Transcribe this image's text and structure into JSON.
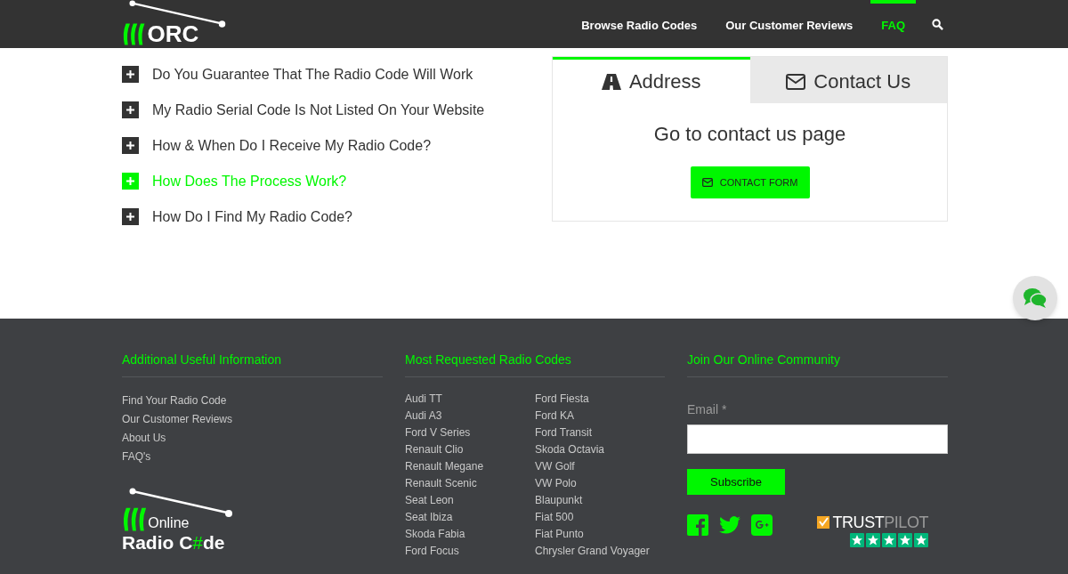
{
  "header": {
    "logo_text": "ORC",
    "nav": [
      {
        "label": "Browse Radio Codes",
        "selected": false
      },
      {
        "label": "Our Customer Reviews",
        "selected": false
      },
      {
        "label": "FAQ",
        "selected": true
      }
    ]
  },
  "faq": [
    {
      "question": "Do You Guarantee That The Radio Code Will Work",
      "selected": false
    },
    {
      "question": "My Radio Serial Code Is Not Listed On Your Website",
      "selected": false
    },
    {
      "question": "How & When Do I Receive My Radio Code?",
      "selected": false
    },
    {
      "question": "How Does The Process Work?",
      "selected": true
    },
    {
      "question": "How Do I Find My Radio Code?",
      "selected": false
    }
  ],
  "contact_panel": {
    "tabs": [
      {
        "label": "Address",
        "kind": "road",
        "selected": true
      },
      {
        "label": "Contact Us",
        "kind": "mail",
        "selected": false
      }
    ],
    "heading": "Go to contact us page",
    "button": "CONTACT FORM"
  },
  "footer": {
    "useful": {
      "title": "Additional Useful Information",
      "links": [
        "Find Your Radio Code",
        "Our Customer Reviews",
        "About Us",
        "FAQ's"
      ]
    },
    "logo": {
      "top": "Online",
      "wordmark": [
        {
          "text": "Radio C",
          "accent": false
        },
        {
          "text": "#",
          "accent": true
        },
        {
          "text": "de",
          "accent": false
        }
      ]
    },
    "requested": {
      "title": "Most Requested Radio Codes",
      "column_1": [
        "Audi TT",
        "Audi A3",
        "Ford V Series",
        "Renault Clio",
        "Renault Megane",
        "Renault Scenic",
        "Seat Leon",
        "Seat Ibiza",
        "Skoda Fabia",
        "Ford Focus"
      ],
      "column_2": [
        "Ford Fiesta",
        "Ford KA",
        "Ford Transit",
        "Skoda Octavia",
        "VW Golf",
        "VW Polo",
        "Blaupunkt",
        "Fiat 500",
        "Fiat Punto",
        "Chrysler Grand Voyager"
      ]
    },
    "community": {
      "title": "Join Our Online Community",
      "email_label": "Email *",
      "button": "Subscribe",
      "social": [
        {
          "kind": "facebook"
        },
        {
          "kind": "twitter"
        },
        {
          "kind": "googleplus"
        }
      ],
      "trustpilot": {
        "part_1": "TRUST",
        "part_2": "PILOT",
        "stars": 5
      }
    }
  }
}
